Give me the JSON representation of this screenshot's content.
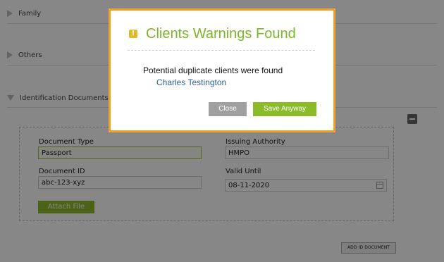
{
  "sections": {
    "family": "Family",
    "others": "Others",
    "identification": "Identification Documents"
  },
  "document": {
    "type_label": "Document Type",
    "type_value": "Passport",
    "authority_label": "Issuing Authority",
    "authority_value": "HMPO",
    "id_label": "Document ID",
    "id_value": "abc-123-xyz",
    "valid_label": "Valid Until",
    "valid_value": "08-11-2020",
    "attach_label": "Attach File"
  },
  "add_id_label": "ADD ID DOCUMENT",
  "modal": {
    "title": "Clients Warnings Found",
    "warning_glyph": "!",
    "message": "Potential duplicate clients were found",
    "client_link": "Charles Testington",
    "close_label": "Close",
    "save_label": "Save Anyway"
  },
  "colors": {
    "accent_green": "#8cbb2a",
    "modal_border": "#f4a024",
    "link_blue": "#2d5c96"
  }
}
